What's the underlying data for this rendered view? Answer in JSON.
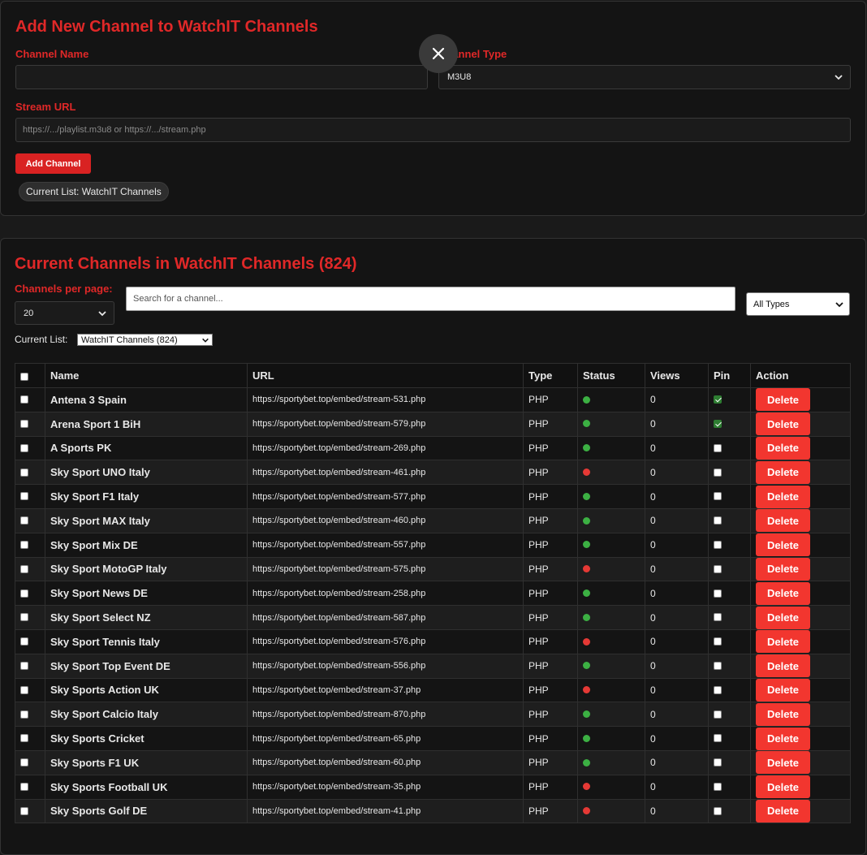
{
  "add_form": {
    "title": "Add New Channel to WatchIT Channels",
    "channel_name_label": "Channel Name",
    "channel_name_value": "",
    "channel_type_label": "Channel Type",
    "channel_type_value": "M3U8",
    "stream_url_label": "Stream URL",
    "stream_url_placeholder": "https://.../playlist.m3u8 or https://.../stream.php",
    "add_button_label": "Add Channel",
    "current_list_pill": "Current List: WatchIT Channels"
  },
  "channels_panel": {
    "title": "Current Channels in WatchIT Channels (824)",
    "per_page_label": "Channels per page:",
    "per_page_value": "20",
    "search_placeholder": "Search for a channel...",
    "type_filter_value": "All Types",
    "current_list_label": "Current List:",
    "current_list_value": "WatchIT Channels (824)"
  },
  "colors": {
    "accent": "#e02828",
    "delete": "#f2362f",
    "status_online": "#3cb043",
    "status_offline": "#e53935"
  },
  "table": {
    "columns": [
      "Name",
      "URL",
      "Type",
      "Status",
      "Views",
      "Pin",
      "Action"
    ],
    "delete_label": "Delete",
    "rows": [
      {
        "name": "Antena 3 Spain",
        "url": "https://sportybet.top/embed/stream-531.php",
        "type": "PHP",
        "status": "online",
        "views": "0",
        "pinned": true
      },
      {
        "name": "Arena Sport 1 BiH",
        "url": "https://sportybet.top/embed/stream-579.php",
        "type": "PHP",
        "status": "online",
        "views": "0",
        "pinned": true
      },
      {
        "name": "A Sports PK",
        "url": "https://sportybet.top/embed/stream-269.php",
        "type": "PHP",
        "status": "online",
        "views": "0",
        "pinned": false
      },
      {
        "name": "Sky Sport UNO Italy",
        "url": "https://sportybet.top/embed/stream-461.php",
        "type": "PHP",
        "status": "offline",
        "views": "0",
        "pinned": false
      },
      {
        "name": "Sky Sport F1 Italy",
        "url": "https://sportybet.top/embed/stream-577.php",
        "type": "PHP",
        "status": "online",
        "views": "0",
        "pinned": false
      },
      {
        "name": "Sky Sport MAX Italy",
        "url": "https://sportybet.top/embed/stream-460.php",
        "type": "PHP",
        "status": "online",
        "views": "0",
        "pinned": false
      },
      {
        "name": "Sky Sport Mix DE",
        "url": "https://sportybet.top/embed/stream-557.php",
        "type": "PHP",
        "status": "online",
        "views": "0",
        "pinned": false
      },
      {
        "name": "Sky Sport MotoGP Italy",
        "url": "https://sportybet.top/embed/stream-575.php",
        "type": "PHP",
        "status": "offline",
        "views": "0",
        "pinned": false
      },
      {
        "name": "Sky Sport News DE",
        "url": "https://sportybet.top/embed/stream-258.php",
        "type": "PHP",
        "status": "online",
        "views": "0",
        "pinned": false
      },
      {
        "name": "Sky Sport Select NZ",
        "url": "https://sportybet.top/embed/stream-587.php",
        "type": "PHP",
        "status": "online",
        "views": "0",
        "pinned": false
      },
      {
        "name": "Sky Sport Tennis Italy",
        "url": "https://sportybet.top/embed/stream-576.php",
        "type": "PHP",
        "status": "offline",
        "views": "0",
        "pinned": false
      },
      {
        "name": "Sky Sport Top Event DE",
        "url": "https://sportybet.top/embed/stream-556.php",
        "type": "PHP",
        "status": "online",
        "views": "0",
        "pinned": false
      },
      {
        "name": "Sky Sports Action UK",
        "url": "https://sportybet.top/embed/stream-37.php",
        "type": "PHP",
        "status": "offline",
        "views": "0",
        "pinned": false
      },
      {
        "name": "Sky Sport Calcio Italy",
        "url": "https://sportybet.top/embed/stream-870.php",
        "type": "PHP",
        "status": "online",
        "views": "0",
        "pinned": false
      },
      {
        "name": "Sky Sports Cricket",
        "url": "https://sportybet.top/embed/stream-65.php",
        "type": "PHP",
        "status": "online",
        "views": "0",
        "pinned": false
      },
      {
        "name": "Sky Sports F1 UK",
        "url": "https://sportybet.top/embed/stream-60.php",
        "type": "PHP",
        "status": "online",
        "views": "0",
        "pinned": false
      },
      {
        "name": "Sky Sports Football UK",
        "url": "https://sportybet.top/embed/stream-35.php",
        "type": "PHP",
        "status": "offline",
        "views": "0",
        "pinned": false
      },
      {
        "name": "Sky Sports Golf DE",
        "url": "https://sportybet.top/embed/stream-41.php",
        "type": "PHP",
        "status": "offline",
        "views": "0",
        "pinned": false
      }
    ]
  }
}
